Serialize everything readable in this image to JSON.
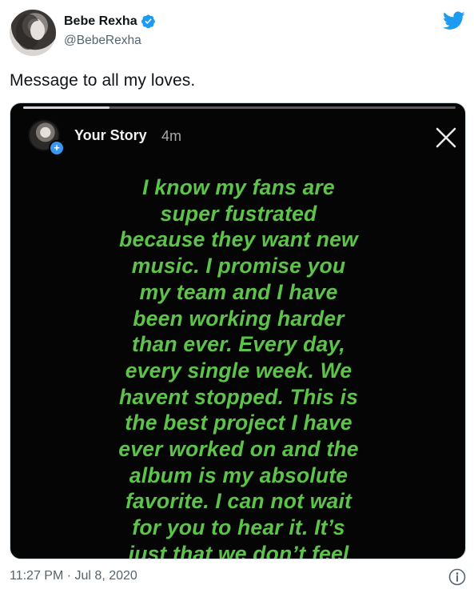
{
  "author": {
    "display_name": "Bebe Rexha",
    "handle": "@BebeRexha",
    "verified_icon": "verified-badge-icon",
    "verified_color": "#1d9bf0"
  },
  "tweet": {
    "text": "Message to all my loves.",
    "timestamp": "11:27 PM · Jul 8, 2020"
  },
  "story": {
    "user": "Your Story",
    "age": "4m",
    "progress": 0.2,
    "text_color": "#5dc34a",
    "lines": [
      "I know my fans are",
      "super fustrated",
      "because they want new",
      "music. I promise you",
      "my team and I have",
      "been working harder",
      "than ever. Every day,",
      "every single week. We",
      "havent stopped. This is",
      "the best project I have",
      "ever worked on and the",
      "album is my absolute",
      "favorite. I can not wait",
      "for you to hear it. It’s",
      "just that we don’t feel"
    ]
  },
  "icons": {
    "brand": "twitter-bird-icon",
    "close": "close-icon",
    "info": "info-icon",
    "brand_color": "#1d9bf0"
  }
}
